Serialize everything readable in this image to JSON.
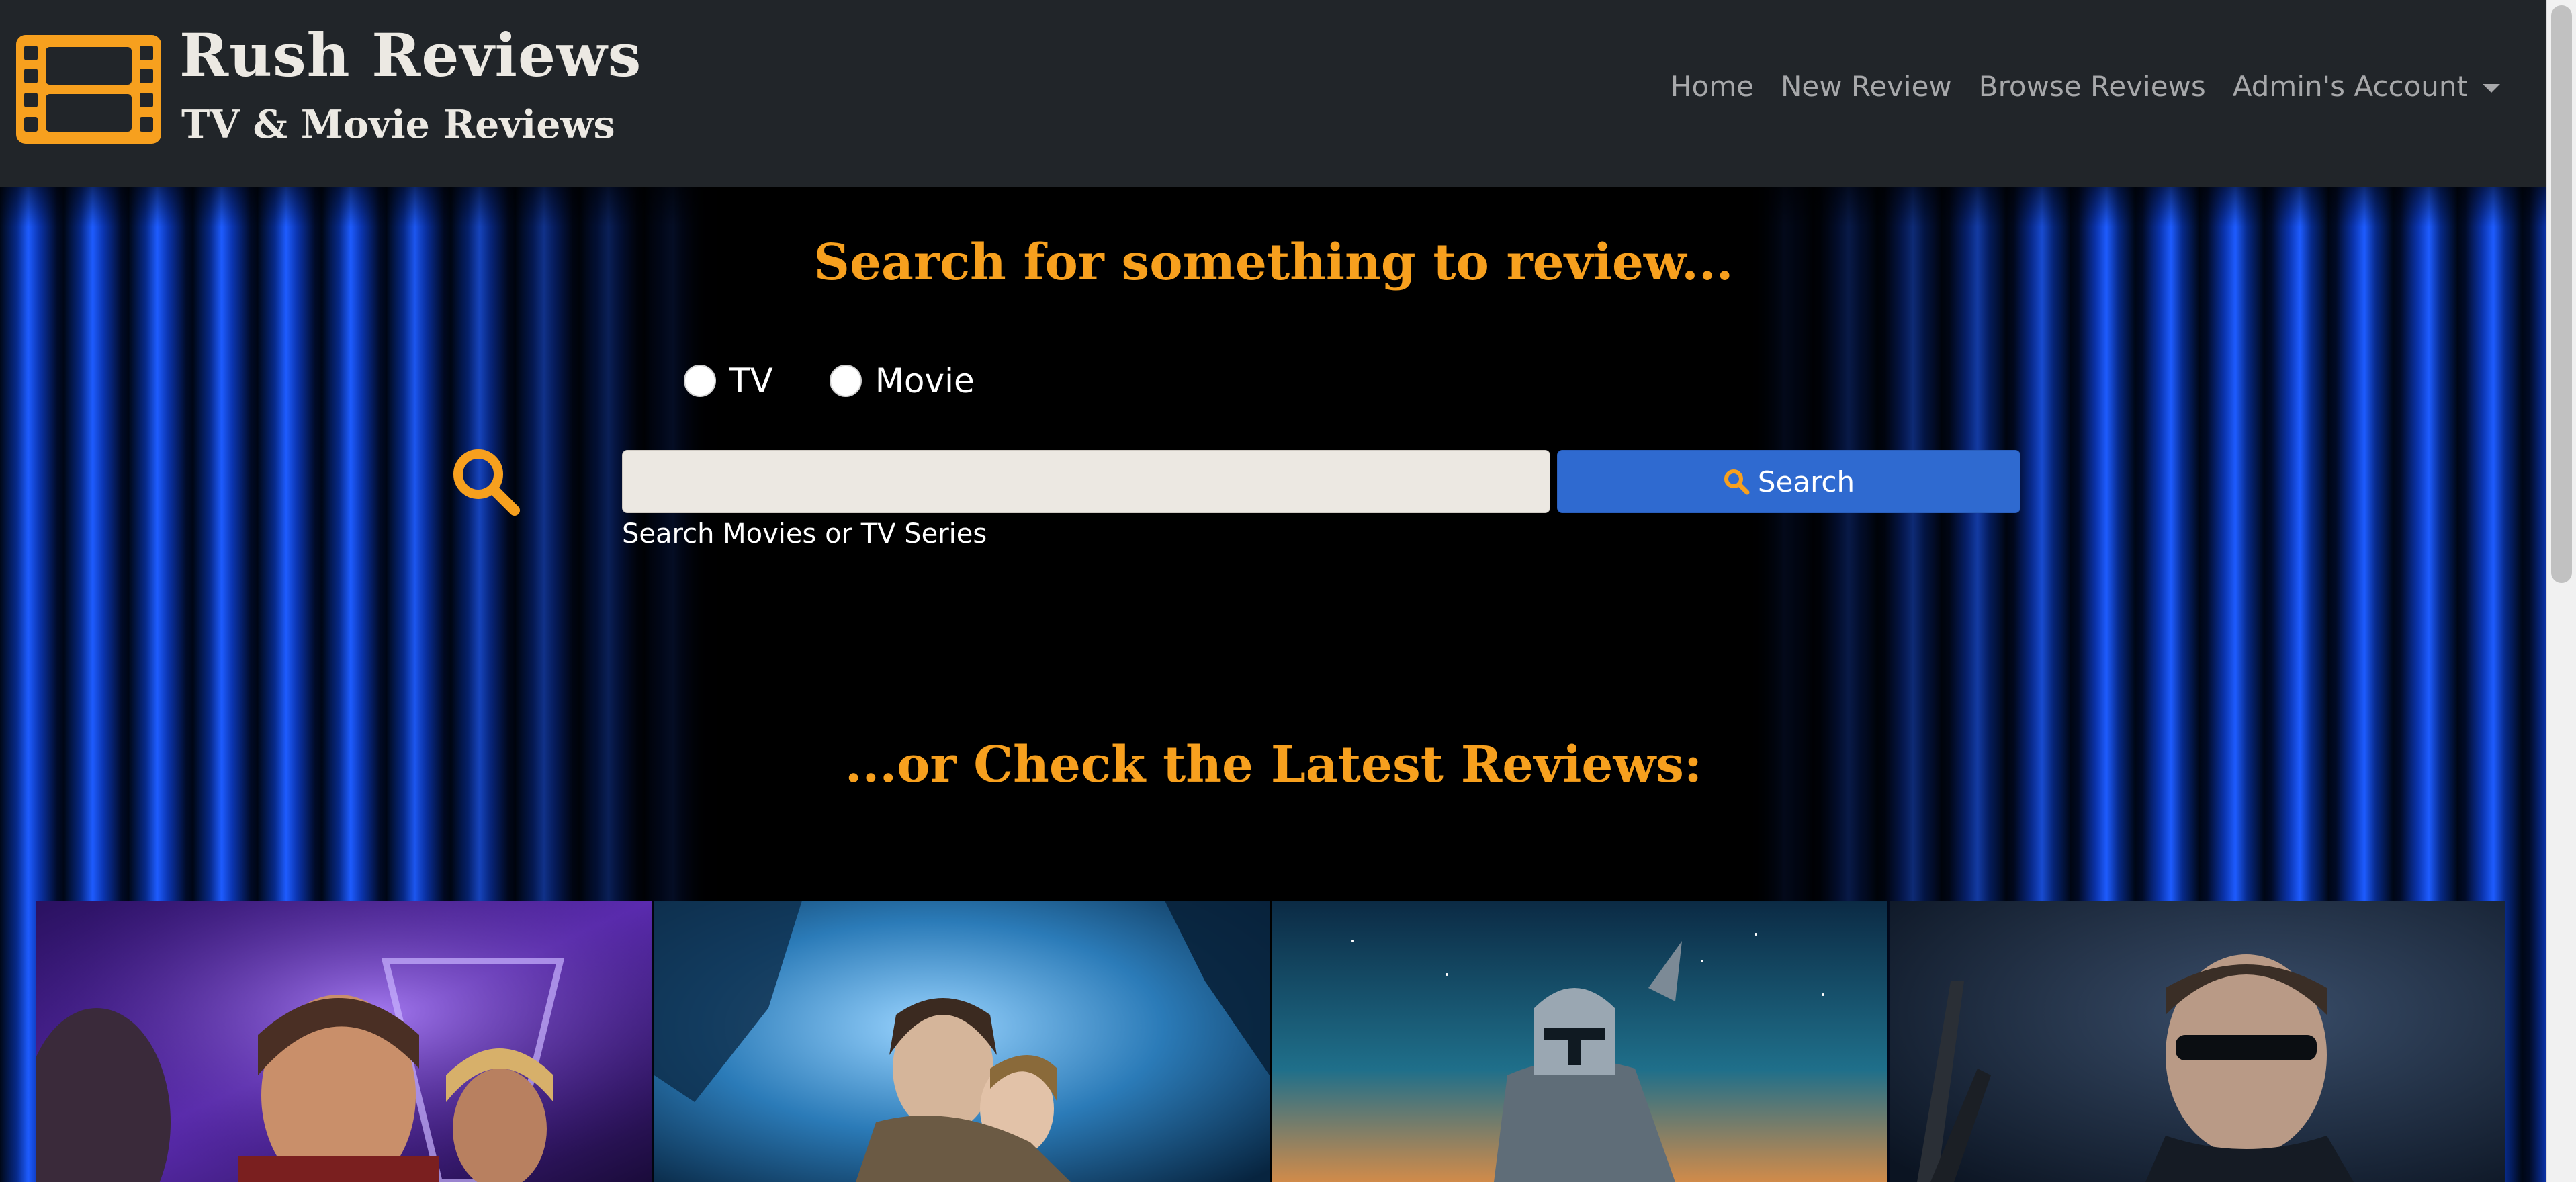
{
  "brand": {
    "title": "Rush Reviews",
    "subtitle": "TV & Movie Reviews",
    "accent_color": "#f7a01e",
    "icon": "film-strip-icon"
  },
  "nav": {
    "items": [
      {
        "label": "Home"
      },
      {
        "label": "New Review"
      },
      {
        "label": "Browse Reviews"
      },
      {
        "label": "Admin's Account",
        "dropdown": true
      }
    ]
  },
  "search": {
    "heading": "Search for something to review...",
    "options": [
      {
        "label": "TV",
        "checked": false
      },
      {
        "label": "Movie",
        "checked": false
      }
    ],
    "input_value": "",
    "placeholder": "",
    "button_label": "Search",
    "help_text": "Search Movies or TV Series",
    "icon": "search-icon"
  },
  "latest": {
    "heading": "...or Check the Latest Reviews:",
    "cards": [
      {
        "poster": "avengers-poster"
      },
      {
        "poster": "aliens-poster"
      },
      {
        "poster": "mandalorian-poster"
      },
      {
        "poster": "terminator-poster"
      }
    ]
  },
  "colors": {
    "navbar": "#212529",
    "button": "#2f6ad0",
    "curtain": "#1e5cff"
  }
}
